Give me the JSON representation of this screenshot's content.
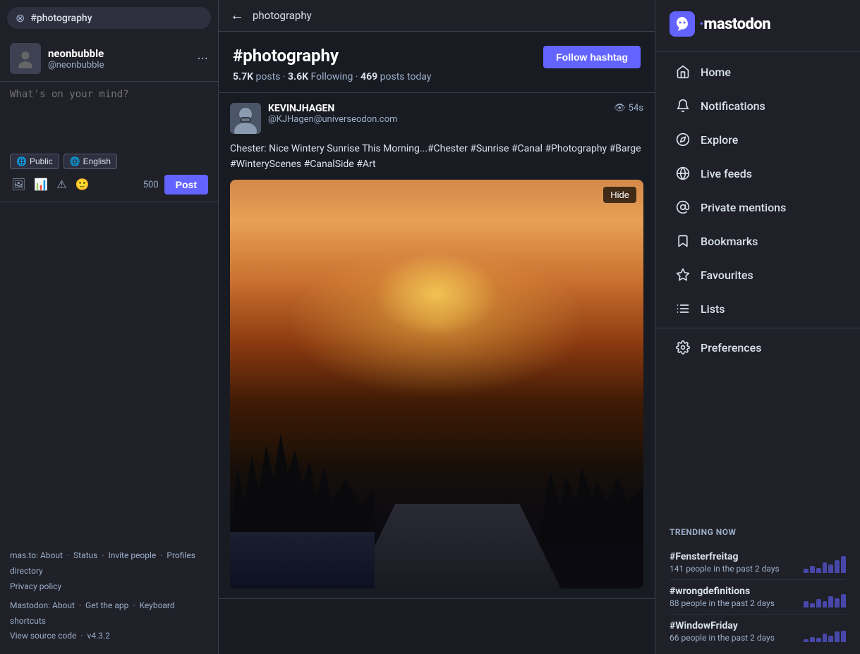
{
  "left_sidebar": {
    "search": {
      "tag": "#photography",
      "close_label": "×"
    },
    "user": {
      "display_name": "neonbubble",
      "handle": "@neonbubble"
    },
    "compose": {
      "placeholder": "What's on your mind?",
      "public_label": "Public",
      "language_label": "English",
      "char_count": "500",
      "post_label": "Post"
    },
    "footer": {
      "mas_to": "mas.to:",
      "about": "About",
      "status": "Status",
      "invite_people": "Invite people",
      "profiles_directory": "Profiles directory",
      "privacy_policy": "Privacy policy",
      "mastodon": "Mastodon",
      "about2": "About",
      "get_the_app": "Get the app",
      "keyboard_shortcuts": "Keyboard shortcuts",
      "view_source_code": "View source code",
      "version": "v4.3.2"
    }
  },
  "main": {
    "header": {
      "back_label": "←",
      "title": "photography"
    },
    "hashtag": {
      "name": "#photography",
      "follow_label": "Follow hashtag",
      "posts_count": "5.7K",
      "posts_label": "posts",
      "following_count": "3.6K",
      "following_label": "Following",
      "today_count": "469",
      "today_label": "posts today"
    },
    "post": {
      "author_name": "KEVINJHAGEN",
      "author_handle": "@KJHagen@universeodon.com",
      "time": "54s",
      "content": "Chester: Nice Wintery Sunrise This Morning...#Chester #Sunrise #Canal #Photography #Barge #WinteryScenes #CanalSide #Art",
      "hide_label": "Hide",
      "image_alt": "Wintery sunrise over a canal path in Chester"
    }
  },
  "right_sidebar": {
    "logo": {
      "text": "mastodon",
      "dot_char": "·"
    },
    "nav": [
      {
        "id": "home",
        "label": "Home",
        "icon": "home"
      },
      {
        "id": "notifications",
        "label": "Notifications",
        "icon": "bell"
      },
      {
        "id": "explore",
        "label": "Explore",
        "icon": "compass"
      },
      {
        "id": "live-feeds",
        "label": "Live feeds",
        "icon": "globe"
      },
      {
        "id": "private-mentions",
        "label": "Private mentions",
        "icon": "at"
      },
      {
        "id": "bookmarks",
        "label": "Bookmarks",
        "icon": "bookmark"
      },
      {
        "id": "favourites",
        "label": "Favourites",
        "icon": "star"
      },
      {
        "id": "lists",
        "label": "Lists",
        "icon": "list"
      },
      {
        "id": "preferences",
        "label": "Preferences",
        "icon": "gear"
      }
    ],
    "trending": {
      "title": "TRENDING NOW",
      "items": [
        {
          "tag": "#Fensterfreitag",
          "count": "141 people in the past 2 days",
          "bars": [
            20,
            35,
            25,
            50,
            40,
            60,
            80
          ]
        },
        {
          "tag": "#wrongdefinitions",
          "count": "88 people in the past 2 days",
          "bars": [
            30,
            20,
            40,
            30,
            55,
            45,
            65
          ]
        },
        {
          "tag": "#WindowFriday",
          "count": "66 people in the past 2 days",
          "bars": [
            15,
            25,
            20,
            40,
            30,
            50,
            55
          ]
        }
      ]
    }
  }
}
